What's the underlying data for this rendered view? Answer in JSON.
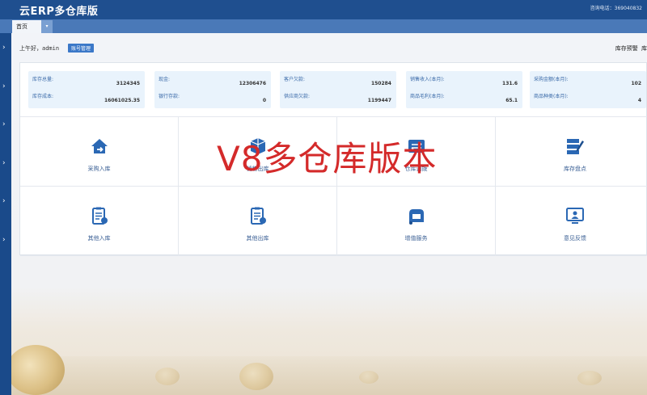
{
  "header": {
    "title": "云ERP多仓库版",
    "hotline": "咨询电话：369040832"
  },
  "tabs": {
    "home_label": "首页",
    "dropdown_glyph": "▾"
  },
  "sidebar": {
    "arrow": "›"
  },
  "greeting": {
    "text": "上午好，admin",
    "badge": "账号管理",
    "stock_alert": "库存预警 库"
  },
  "stats": [
    {
      "k1": "库存总量:",
      "v1": "3124345",
      "k2": "库存成本:",
      "v2": "16061025.35"
    },
    {
      "k1": "现金:",
      "v1": "12306476",
      "k2": "银行存款:",
      "v2": "0"
    },
    {
      "k1": "客户欠款:",
      "v1": "150284",
      "k2": "供应商欠款:",
      "v2": "1199447"
    },
    {
      "k1": "销售收入(本月):",
      "v1": "131.6",
      "k2": "商品毛利(本月):",
      "v2": "65.1"
    },
    {
      "k1": "采购金额(本月):",
      "v1": "102",
      "k2": "商品种类(本月):",
      "v2": "4"
    }
  ],
  "tiles": [
    {
      "label": "采购入库",
      "icon": "house-in-icon"
    },
    {
      "label": "销售出库",
      "icon": "cart-out-icon"
    },
    {
      "label": "仓库调拨",
      "icon": "transfer-icon"
    },
    {
      "label": "库存盘点",
      "icon": "inventory-check-icon"
    },
    {
      "label": "其他入库",
      "icon": "clipboard-in-icon"
    },
    {
      "label": "其他出库",
      "icon": "clipboard-out-icon"
    },
    {
      "label": "增值服务",
      "icon": "service-icon"
    },
    {
      "label": "意见反馈",
      "icon": "feedback-icon"
    }
  ],
  "watermark": "V8多仓库版本",
  "colors": {
    "primary": "#1f4f8f",
    "tab_bar": "#4a79b8",
    "accent_icon": "#2b68b4",
    "watermark": "#d42a2a"
  }
}
